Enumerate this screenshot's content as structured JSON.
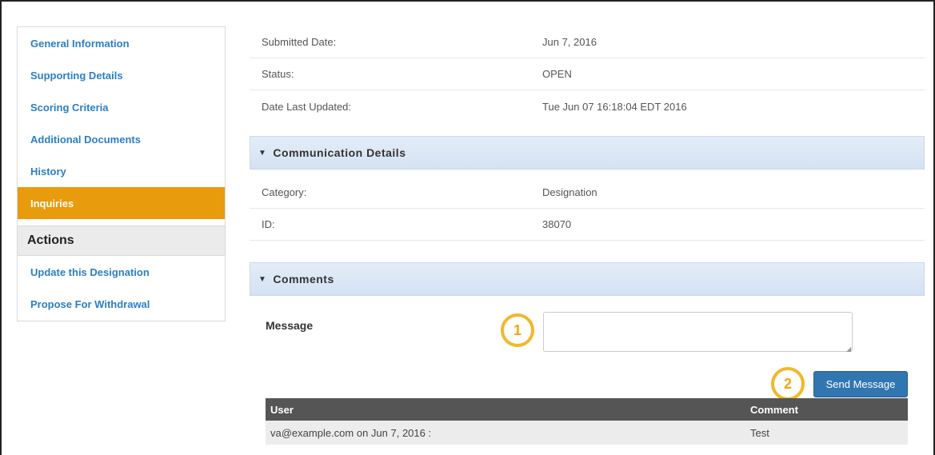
{
  "sidebar": {
    "nav_items": [
      {
        "label": "General Information",
        "active": false
      },
      {
        "label": "Supporting Details",
        "active": false
      },
      {
        "label": "Scoring Criteria",
        "active": false
      },
      {
        "label": "Additional Documents",
        "active": false
      },
      {
        "label": "History",
        "active": false
      },
      {
        "label": "Inquiries",
        "active": true
      }
    ],
    "actions_title": "Actions",
    "action_items": [
      {
        "label": "Update this Designation"
      },
      {
        "label": "Propose For Withdrawal"
      }
    ]
  },
  "summary": [
    {
      "label": "Submitted Date:",
      "value": "Jun 7, 2016"
    },
    {
      "label": "Status:",
      "value": "OPEN"
    },
    {
      "label": "Date Last Updated:",
      "value": "Tue Jun 07 16:18:04 EDT 2016"
    }
  ],
  "communication": {
    "title": "Communication Details",
    "rows": [
      {
        "label": "Category:",
        "value": "Designation"
      },
      {
        "label": "ID:",
        "value": "38070"
      }
    ]
  },
  "comments": {
    "title": "Comments",
    "message_label": "Message",
    "message_value": "",
    "send_label": "Send Message",
    "table": {
      "headers": [
        "User",
        "Comment"
      ],
      "rows": [
        [
          "va@example.com on Jun 7, 2016 :",
          "Test"
        ]
      ]
    }
  },
  "markers": [
    "1",
    "2"
  ],
  "colors": {
    "link": "#2b7fc3",
    "active_nav": "#e89b0c",
    "section_bar": "#dbe6f4",
    "button": "#3276b1",
    "marker": "#f2b82c",
    "table_header": "#555555"
  },
  "icons": {
    "caret": "caret-down-icon",
    "grip": "resize-grip-icon"
  }
}
